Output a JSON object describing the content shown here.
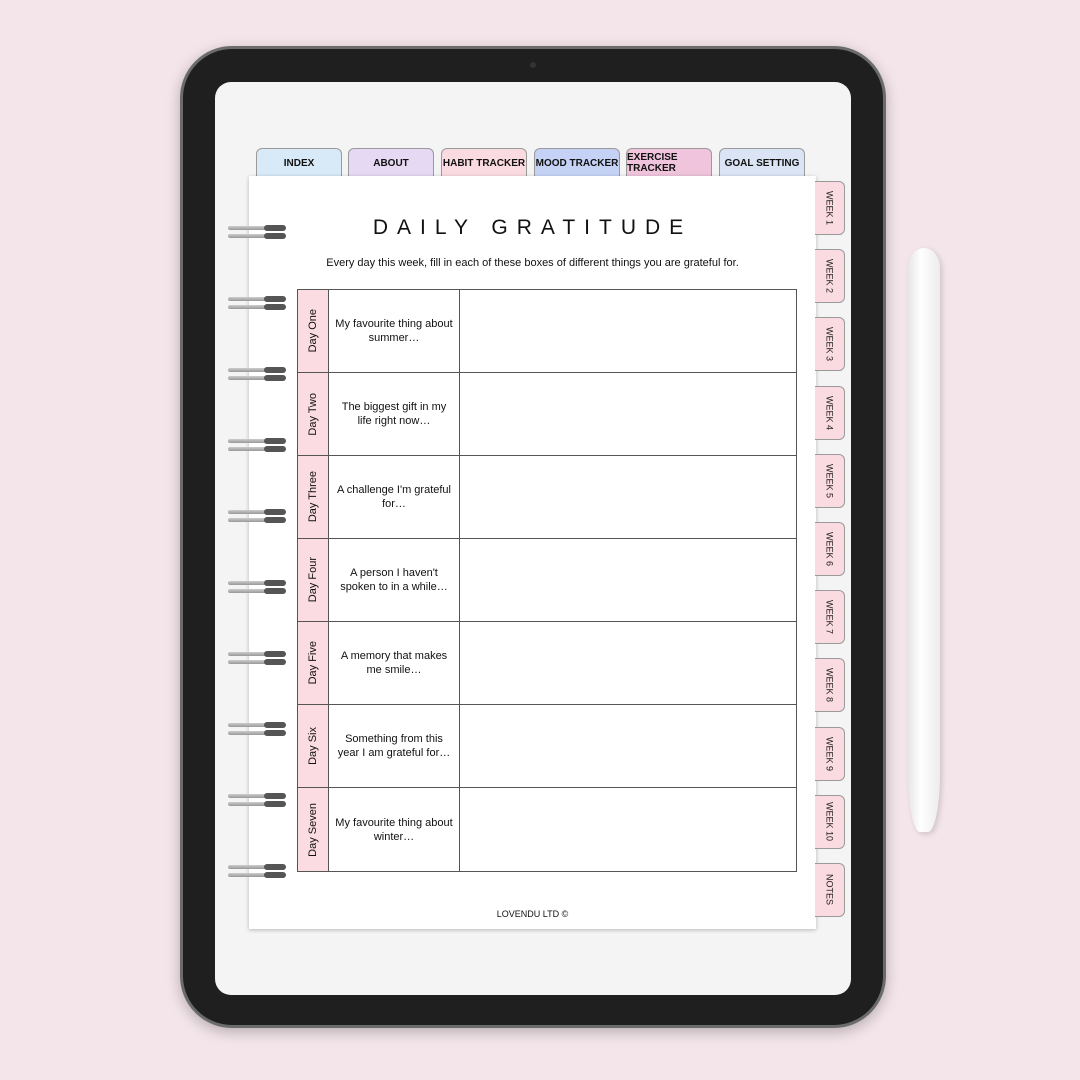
{
  "top_tabs": [
    {
      "label": "INDEX",
      "color": "#d8eaf8"
    },
    {
      "label": "ABOUT",
      "color": "#e5d9f3"
    },
    {
      "label": "HABIT TRACKER",
      "color": "#fbdbe2"
    },
    {
      "label": "MOOD TRACKER",
      "color": "#c5d2f5"
    },
    {
      "label": "EXERCISE TRACKER",
      "color": "#efc4dc"
    },
    {
      "label": "GOAL SETTING",
      "color": "#dbe4f4"
    }
  ],
  "side_tabs": [
    "WEEK 1",
    "WEEK 2",
    "WEEK 3",
    "WEEK 4",
    "WEEK 5",
    "WEEK 6",
    "WEEK 7",
    "WEEK 8",
    "WEEK 9",
    "WEEK 10",
    "NOTES"
  ],
  "title": "DAILY GRATITUDE",
  "subtitle": "Every day this week, fill in each of these boxes of different things you are grateful for.",
  "days": [
    {
      "day": "Day One",
      "prompt": "My favourite thing about summer…"
    },
    {
      "day": "Day Two",
      "prompt": "The biggest gift in my life right now…"
    },
    {
      "day": "Day Three",
      "prompt": "A challenge I'm grateful for…"
    },
    {
      "day": "Day Four",
      "prompt": "A person I haven't spoken to in a while…"
    },
    {
      "day": "Day Five",
      "prompt": "A memory that makes me smile…"
    },
    {
      "day": "Day Six",
      "prompt": "Something from this year I am grateful for…"
    },
    {
      "day": "Day Seven",
      "prompt": "My favourite thing about winter…"
    }
  ],
  "footer": "LOVENDU LTD ©"
}
